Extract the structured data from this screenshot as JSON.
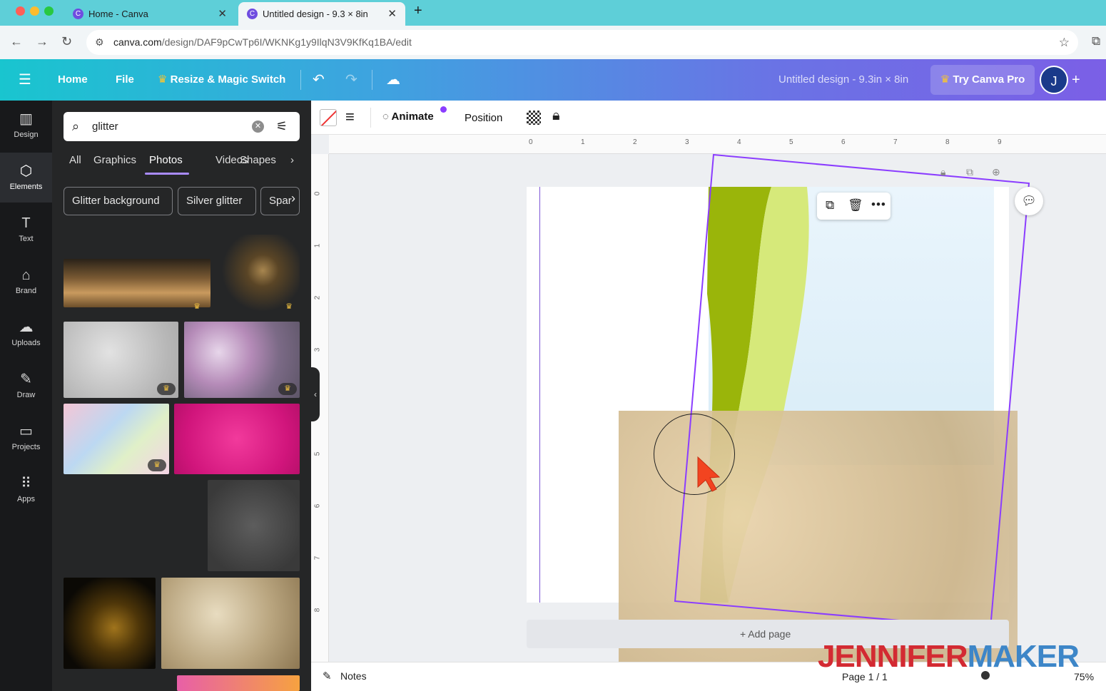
{
  "browser": {
    "tabs": [
      {
        "title": "Home - Canva"
      },
      {
        "title": "Untitled design - 9.3 × 8in"
      }
    ],
    "url_host": "canva.com",
    "url_path": "/design/DAF9pCwTp6I/WKNKg1y9IlqN3V9KfKq1BA/edit"
  },
  "header": {
    "home": "Home",
    "file": "File",
    "resize": "Resize & Magic Switch",
    "doc_title": "Untitled design - 9.3in × 8in",
    "try_pro": "Try Canva Pro",
    "avatar_initial": "J"
  },
  "rail": [
    {
      "label": "Design",
      "icon": "▥"
    },
    {
      "label": "Elements",
      "icon": "⬡"
    },
    {
      "label": "Text",
      "icon": "T"
    },
    {
      "label": "Brand",
      "icon": "⌂"
    },
    {
      "label": "Uploads",
      "icon": "☁"
    },
    {
      "label": "Draw",
      "icon": "✎"
    },
    {
      "label": "Projects",
      "icon": "▭"
    },
    {
      "label": "Apps",
      "icon": "⠿"
    }
  ],
  "panel": {
    "search_value": "glitter",
    "categories": [
      "All",
      "Graphics",
      "Photos",
      "Videos",
      "Shapes"
    ],
    "selected_category": "Photos",
    "chips": [
      "Glitter background",
      "Silver glitter",
      "Spar"
    ]
  },
  "toolbar": {
    "animate": "Animate",
    "position": "Position"
  },
  "ruler": {
    "h": [
      "0",
      "1",
      "2",
      "3",
      "4",
      "5",
      "6",
      "7",
      "8",
      "9"
    ],
    "v": [
      "0",
      "1",
      "2",
      "3",
      "4",
      "5",
      "6",
      "7",
      "8"
    ]
  },
  "canvas": {
    "add_page": "+ Add page",
    "watermark_a": "JENNIFER",
    "watermark_b": "MAKER"
  },
  "footer": {
    "notes": "Notes",
    "page": "Page 1 / 1",
    "zoom": "75%"
  },
  "colors": {
    "accent": "#8b3dff",
    "header_start": "#19c5cf",
    "header_end": "#7b5fe6",
    "watermark_red": "#d32a32",
    "watermark_blue": "#3d86c8"
  }
}
